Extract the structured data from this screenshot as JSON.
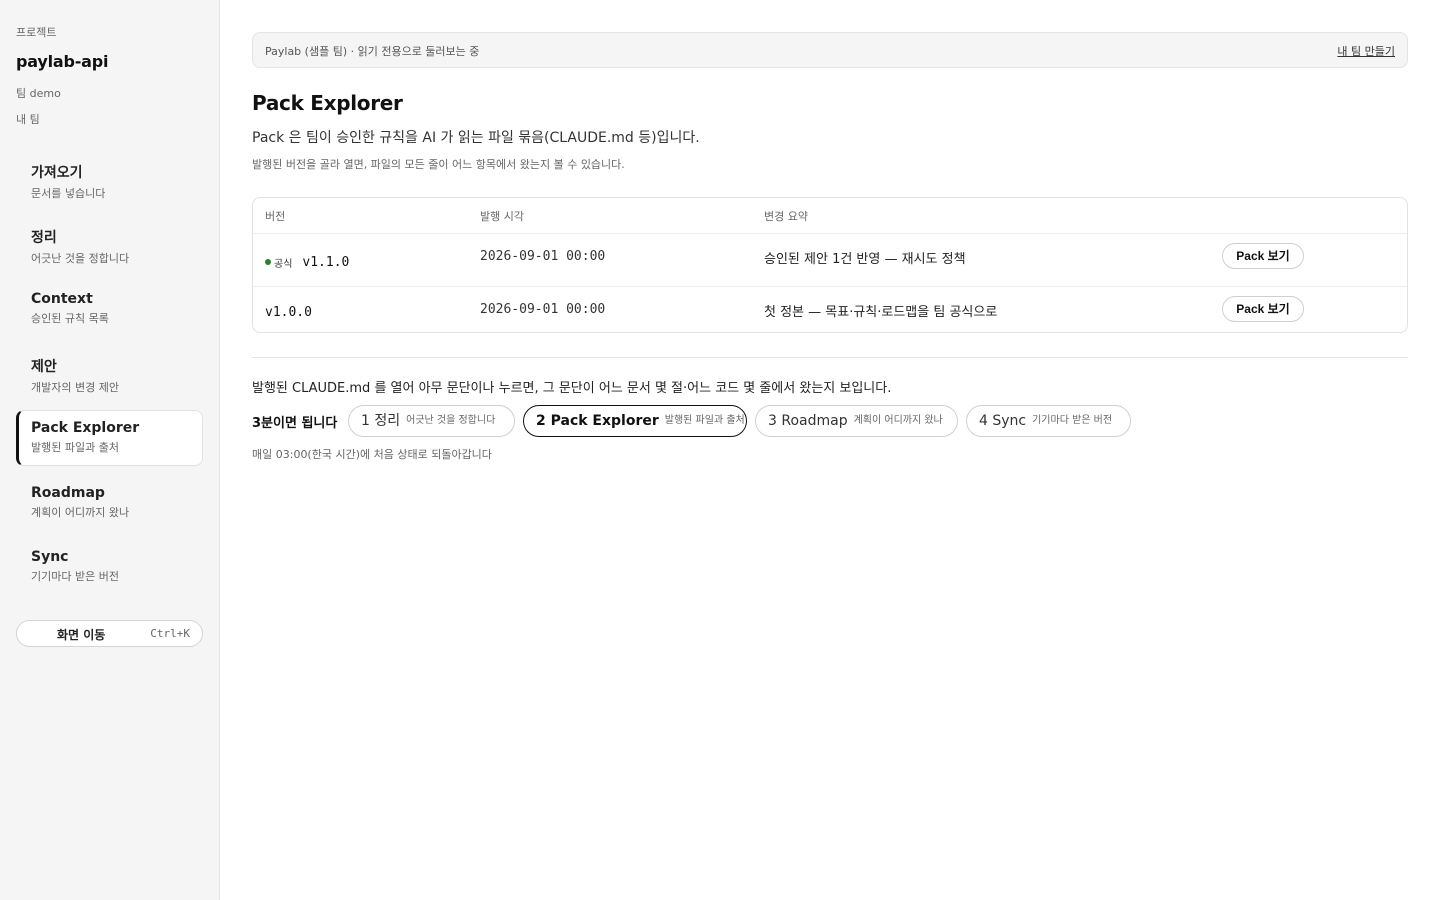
{
  "sidebar": {
    "eyebrow": "프로젝트",
    "project_name": "paylab-api",
    "team_label": "팀 demo",
    "my_team_label": "내 팀",
    "nav": [
      {
        "title": "가져오기",
        "sub": "문서를 넣습니다"
      },
      {
        "title": "정리",
        "sub": "어긋난 것을 정합니다"
      },
      {
        "title": "Context",
        "sub": "승인된 규칙 목록"
      },
      {
        "title": "제안",
        "sub": "개발자의 변경 제안"
      },
      {
        "title": "Pack Explorer",
        "sub": "발행된 파일과 출처"
      },
      {
        "title": "Roadmap",
        "sub": "계획이 어디까지 왔나"
      },
      {
        "title": "Sync",
        "sub": "기기마다 받은 버전"
      }
    ],
    "command_label": "화면 이동",
    "command_shortcut": "Ctrl+K"
  },
  "banner": {
    "text": "Paylab (샘플 팀) · 읽기 전용으로 둘러보는 중",
    "link": "내 팀 만들기"
  },
  "page": {
    "title": "Pack Explorer",
    "description": "Pack 은 팀이 승인한 규칙을 AI 가 읽는 파일 묶음(CLAUDE.md 등)입니다.",
    "subdescription": "발행된 버전을 골라 열면, 파일의 모든 줄이 어느 항목에서 왔는지 볼 수 있습니다."
  },
  "table": {
    "headers": {
      "version": "버전",
      "published_at": "발행 시각",
      "summary": "변경 요약"
    },
    "rows": [
      {
        "status": "공식",
        "version": "v1.1.0",
        "published_at": "2026-09-01 00:00",
        "summary": "승인된 제안 1건 반영 — 재시도 정책",
        "action": "Pack 보기"
      },
      {
        "status": "",
        "version": "v1.0.0",
        "published_at": "2026-09-01 00:00",
        "summary": "첫 정본 — 목표·규칙·로드맵을 팀 공식으로",
        "action": "Pack 보기"
      }
    ]
  },
  "hint": "발행된 CLAUDE.md 를 열어 아무 문단이나 누르면, 그 문단이 어느 문서 몇 절·어느 코드 몇 줄에서 왔는지 보입니다.",
  "tour": {
    "label": "3분이면 됩니다",
    "steps": [
      {
        "title": "1 정리",
        "sub": "어긋난 것을 정합니다"
      },
      {
        "title": "2 Pack Explorer",
        "sub": "발행된 파일과 출처"
      },
      {
        "title": "3 Roadmap",
        "sub": "계획이 어디까지 왔나"
      },
      {
        "title": "4 Sync",
        "sub": "기기마다 받은 버전"
      }
    ],
    "reset_note": "매일 03:00(한국 시간)에 처음 상태로 되돌아갑니다"
  },
  "colors": {
    "official_dot": "#2e7d32",
    "sidebar_bg": "#f5f5f5",
    "active_border": "#111111"
  }
}
